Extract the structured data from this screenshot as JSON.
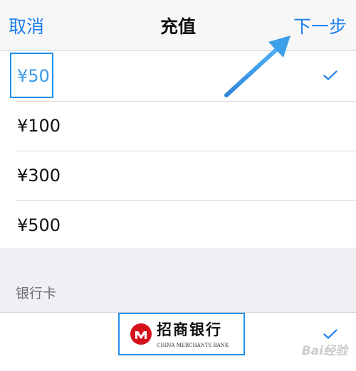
{
  "nav": {
    "cancel_label": "取消",
    "title": "充值",
    "next_label": "下一步"
  },
  "amounts": [
    {
      "label": "¥50",
      "selected": true
    },
    {
      "label": "¥100",
      "selected": false
    },
    {
      "label": "¥300",
      "selected": false
    },
    {
      "label": "¥500",
      "selected": false
    }
  ],
  "payment": {
    "section_header": "银行卡",
    "bank_name": "招商银行",
    "bank_name_en": "CHINA MERCHANTS BANK",
    "selected": true
  },
  "watermark": "Bai经验",
  "colors": {
    "accent": "#1c7ef0",
    "selected_text": "#3a9bec",
    "highlight": "#1f8fec",
    "bank_red": "#d5121c"
  },
  "icons": {
    "checkmark": "check-icon",
    "arrow": "arrow-annotation",
    "bank_logo": "cmb-logo-icon"
  }
}
